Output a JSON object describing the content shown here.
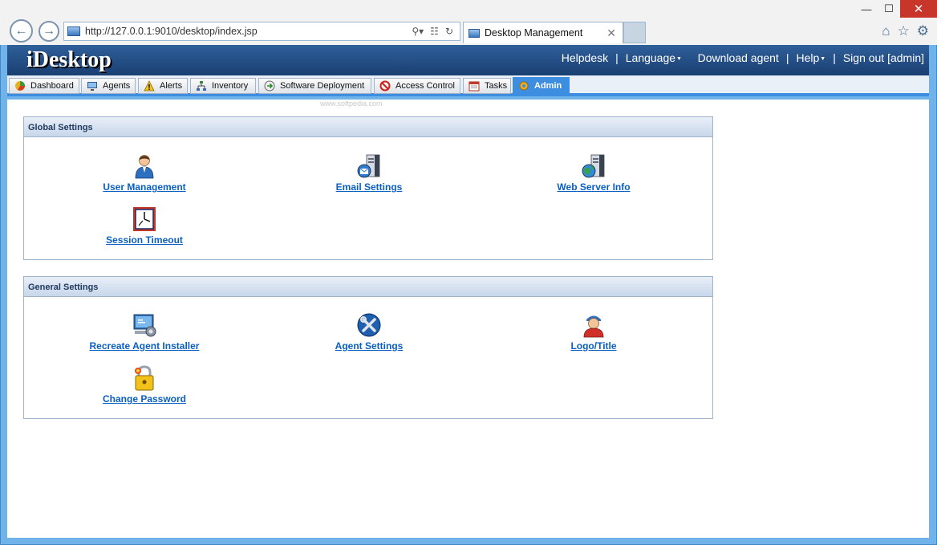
{
  "browser": {
    "url": "http://127.0.0.1:9010/desktop/index.jsp",
    "tab_title": "Desktop Management",
    "window_controls": {
      "minimize": "—",
      "maximize": "☐",
      "close": "✕"
    }
  },
  "app": {
    "logo": "iDesktop",
    "topnav": [
      {
        "label": "Helpdesk"
      },
      {
        "label": "Language"
      },
      {
        "label": "Download agent"
      },
      {
        "label": "Help"
      },
      {
        "label": "Sign out [admin]"
      }
    ],
    "separator": "|",
    "tabs": [
      {
        "label": "Dashboard",
        "icon": "dashboard-icon"
      },
      {
        "label": "Agents",
        "icon": "monitor-icon"
      },
      {
        "label": "Alerts",
        "icon": "warning-icon"
      },
      {
        "label": "Inventory",
        "icon": "network-icon"
      },
      {
        "label": "Software Deployment",
        "icon": "deployment-icon"
      },
      {
        "label": "Access Control",
        "icon": "no-entry-icon"
      },
      {
        "label": "Tasks",
        "icon": "calendar-icon"
      },
      {
        "label": "Admin",
        "icon": "gear-icon",
        "active": true
      }
    ],
    "watermark": "www.softpedia.com"
  },
  "panels": {
    "global": {
      "title": "Global Settings",
      "items": [
        {
          "label": "User Management",
          "icon": "user-icon"
        },
        {
          "label": "Email Settings",
          "icon": "email-server-icon"
        },
        {
          "label": "Web Server Info",
          "icon": "web-server-icon"
        },
        {
          "label": "Session Timeout",
          "icon": "clock-icon"
        }
      ]
    },
    "general": {
      "title": "General Settings",
      "items": [
        {
          "label": "Recreate Agent Installer",
          "icon": "installer-icon"
        },
        {
          "label": "Agent Settings",
          "icon": "tools-icon"
        },
        {
          "label": "Logo/Title",
          "icon": "person-logo-icon"
        },
        {
          "label": "Change Password",
          "icon": "lock-icon"
        }
      ]
    }
  },
  "colors": {
    "accent": "#3d8ee0",
    "header": "#1f4a80",
    "link": "#0a5fc2"
  }
}
